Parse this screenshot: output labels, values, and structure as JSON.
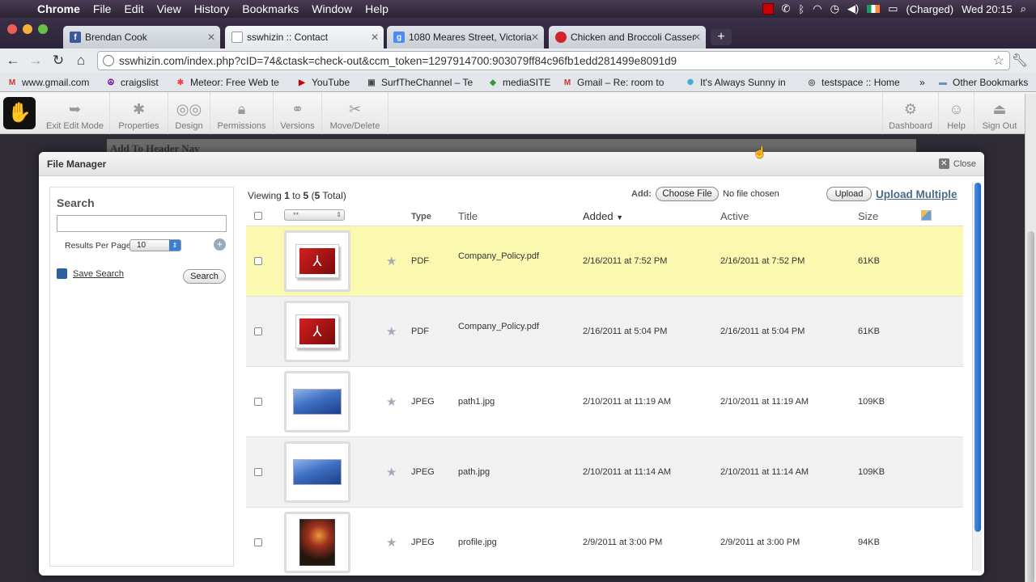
{
  "menubar": {
    "app": "Chrome",
    "items": [
      "File",
      "Edit",
      "View",
      "History",
      "Bookmarks",
      "Window",
      "Help"
    ],
    "battery": "(Charged)",
    "clock": "Wed 20:15"
  },
  "tabs": [
    {
      "label": "Brendan Cook",
      "icon": "facebook-icon",
      "color": "#3b5998",
      "letter": "f"
    },
    {
      "label": "sswhizin :: Contact",
      "icon": "page-icon",
      "color": "#ffffff",
      "letter": ""
    },
    {
      "label": "1080 Meares Street, Victoria",
      "icon": "google-maps-icon",
      "color": "#4a8bf5",
      "letter": "g"
    },
    {
      "label": "Chicken and Broccoli Casserole",
      "icon": "strawberry-icon",
      "color": "#d2222d",
      "letter": "•"
    }
  ],
  "url": "sswhizin.com/index.php?cID=74&ctask=check-out&ccm_token=1297914700:903079ff84c96fb1edd281499e8091d9",
  "bookmarks": [
    {
      "label": "www.gmail.com",
      "icon": "gmail-icon"
    },
    {
      "label": "craigslist",
      "icon": "peace-icon"
    },
    {
      "label": "Meteor: Free Web te",
      "icon": "meteor-icon"
    },
    {
      "label": "YouTube",
      "icon": "youtube-icon"
    },
    {
      "label": "SurfTheChannel – Te",
      "icon": "tv-icon"
    },
    {
      "label": "mediaSITE",
      "icon": "mediasite-icon"
    },
    {
      "label": "Gmail – Re: room to",
      "icon": "gmail-icon"
    },
    {
      "label": "It's Always Sunny in",
      "icon": "sunny-icon"
    },
    {
      "label": "testspace :: Home",
      "icon": "testspace-icon"
    }
  ],
  "bookmarks_more": "»",
  "other_bookmarks": "Other Bookmarks",
  "cms": {
    "left": [
      "Exit Edit Mode",
      "Properties",
      "Design",
      "Permissions",
      "Versions",
      "Move/Delete"
    ],
    "right": [
      "Dashboard",
      "Help",
      "Sign Out"
    ]
  },
  "page": {
    "strip": "Add To Header Nav"
  },
  "modal": {
    "title": "File Manager",
    "close": "Close",
    "search": {
      "title": "Search",
      "query": "",
      "rpp_label": "Results Per Page",
      "rpp_value": "10",
      "save": "Save Search",
      "button": "Search"
    },
    "viewing": {
      "prefix": "Viewing",
      "from": "1",
      "to_word": "to",
      "to": "5",
      "total": "5",
      "total_word": "Total"
    },
    "add_label": "Add:",
    "choose_file": "Choose File",
    "no_file": "No file chosen",
    "upload": "Upload",
    "upload_multiple": "Upload Multiple",
    "bulk_select": "**",
    "columns": {
      "type": "Type",
      "title": "Title",
      "added": "Added",
      "active": "Active",
      "size": "Size"
    },
    "files": [
      {
        "type": "PDF",
        "title": "Company_Policy.pdf",
        "added": "2/16/2011 at 7:52 PM",
        "active": "2/16/2011 at 7:52 PM",
        "size": "61KB",
        "thumb": "pdf"
      },
      {
        "type": "PDF",
        "title": "Company_Policy.pdf",
        "added": "2/16/2011 at 5:04 PM",
        "active": "2/16/2011 at 5:04 PM",
        "size": "61KB",
        "thumb": "pdf"
      },
      {
        "type": "JPEG",
        "title": "path1.jpg",
        "added": "2/10/2011 at 11:19 AM",
        "active": "2/10/2011 at 11:19 AM",
        "size": "109KB",
        "thumb": "image"
      },
      {
        "type": "JPEG",
        "title": "path.jpg",
        "added": "2/10/2011 at 11:14 AM",
        "active": "2/10/2011 at 11:14 AM",
        "size": "109KB",
        "thumb": "image"
      },
      {
        "type": "JPEG",
        "title": "profile.jpg",
        "added": "2/9/2011 at 3:00 PM",
        "active": "2/9/2011 at 3:00 PM",
        "size": "94KB",
        "thumb": "portrait"
      }
    ]
  }
}
